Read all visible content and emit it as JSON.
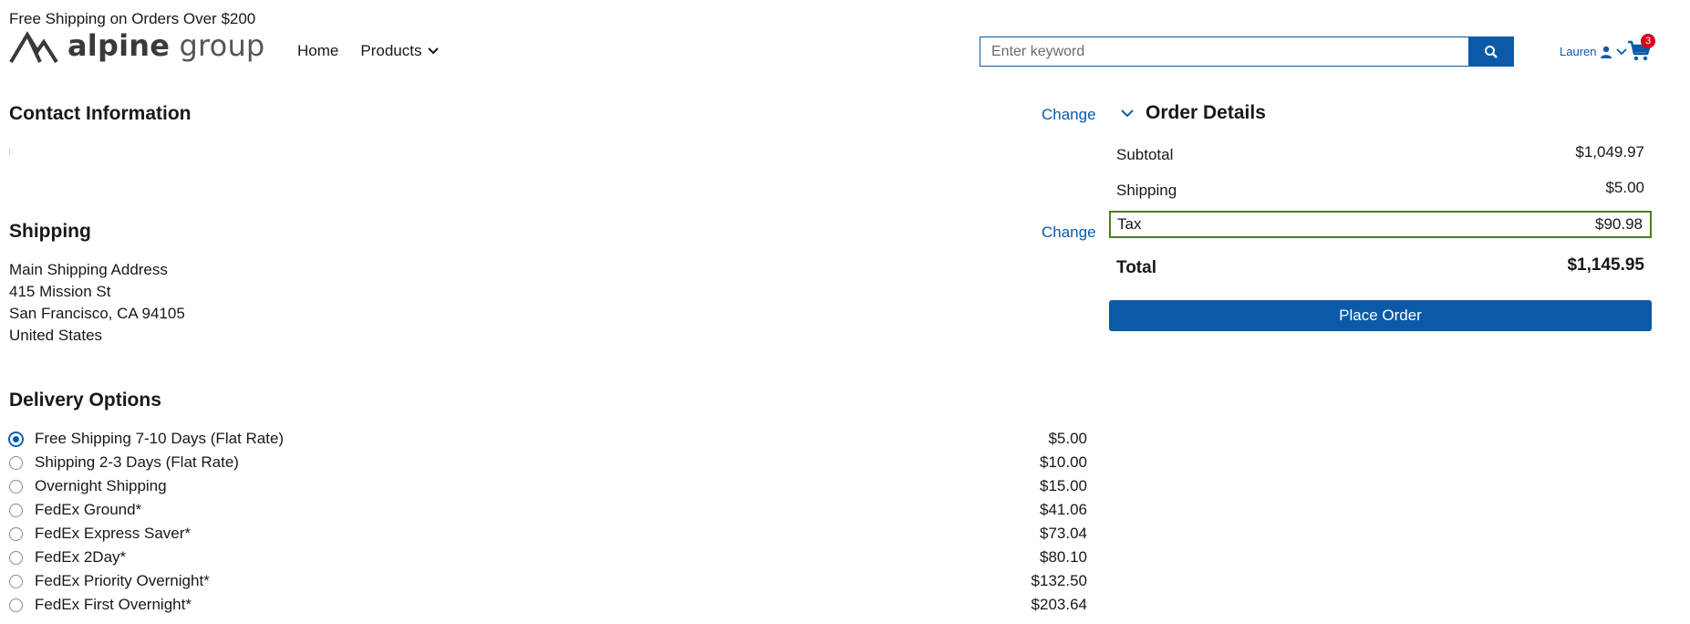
{
  "header": {
    "promo": "Free Shipping on Orders Over $200",
    "logo_word1": "alpine",
    "logo_word2": "group",
    "nav": [
      {
        "label": "Home"
      },
      {
        "label": "Products"
      }
    ],
    "search": {
      "placeholder": "Enter keyword",
      "value": ""
    },
    "user_name": "Lauren",
    "cart_count": "3"
  },
  "contact": {
    "title": "Contact Information",
    "change_label": "Change"
  },
  "shipping": {
    "title": "Shipping",
    "change_label": "Change",
    "address": {
      "line1": "Main Shipping Address",
      "line2": "415 Mission St",
      "line3": "San Francisco, CA 94105",
      "line4": "United States"
    }
  },
  "delivery": {
    "title": "Delivery Options",
    "options": [
      {
        "label": "Free Shipping 7-10 Days (Flat Rate)",
        "price": "$5.00",
        "selected": true
      },
      {
        "label": "Shipping 2-3 Days (Flat Rate)",
        "price": "$10.00",
        "selected": false
      },
      {
        "label": "Overnight Shipping",
        "price": "$15.00",
        "selected": false
      },
      {
        "label": "FedEx Ground*",
        "price": "$41.06",
        "selected": false
      },
      {
        "label": "FedEx Express Saver*",
        "price": "$73.04",
        "selected": false
      },
      {
        "label": "FedEx 2Day*",
        "price": "$80.10",
        "selected": false
      },
      {
        "label": "FedEx Priority Overnight*",
        "price": "$132.50",
        "selected": false
      },
      {
        "label": "FedEx First Overnight*",
        "price": "$203.64",
        "selected": false
      }
    ]
  },
  "order": {
    "title": "Order Details",
    "subtotal_label": "Subtotal",
    "subtotal": "$1,049.97",
    "shipping_label": "Shipping",
    "shipping": "$5.00",
    "tax_label": "Tax",
    "tax": "$90.98",
    "total_label": "Total",
    "total": "$1,145.95",
    "place_order_label": "Place Order"
  },
  "colors": {
    "accent": "#0a5aa8",
    "badge": "#d9001b",
    "highlight_border": "#4a7f20"
  }
}
